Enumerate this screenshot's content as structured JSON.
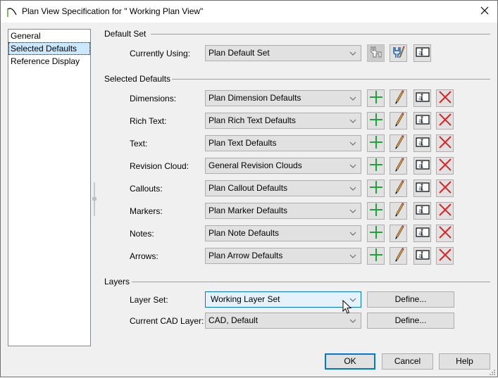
{
  "window": {
    "title": "Plan View Specification for \" Working Plan View\"",
    "app_icon": "arch-icon",
    "close_icon": "close-icon"
  },
  "nav": {
    "items": [
      {
        "label": "General",
        "selected": false
      },
      {
        "label": "Selected Defaults",
        "selected": true
      },
      {
        "label": "Reference Display",
        "selected": false
      }
    ]
  },
  "default_set": {
    "header": "Default Set",
    "label": "Currently Using:",
    "value": "Plan Default Set",
    "buttons": [
      {
        "icon": "save-defaults-icon",
        "enabled": false
      },
      {
        "icon": "edit-defaults-icon",
        "enabled": true
      },
      {
        "icon": "rename-icon",
        "enabled": true
      }
    ]
  },
  "selected_defaults": {
    "header": "Selected Defaults",
    "rows": [
      {
        "label": "Dimensions:",
        "value": "Plan Dimension Defaults"
      },
      {
        "label": "Rich Text:",
        "value": "Plan Rich Text Defaults"
      },
      {
        "label": "Text:",
        "value": "Plan Text Defaults"
      },
      {
        "label": "Revision Cloud:",
        "value": "General Revision Clouds"
      },
      {
        "label": "Callouts:",
        "value": "Plan Callout Defaults"
      },
      {
        "label": "Markers:",
        "value": "Plan Marker Defaults"
      },
      {
        "label": "Notes:",
        "value": "Plan Note Defaults"
      },
      {
        "label": "Arrows:",
        "value": "Plan Arrow Defaults"
      }
    ],
    "row_buttons": [
      {
        "icon": "add-icon"
      },
      {
        "icon": "edit-pencil-icon"
      },
      {
        "icon": "rename-icon"
      },
      {
        "icon": "delete-icon"
      }
    ]
  },
  "layers": {
    "header": "Layers",
    "layer_set_label": "Layer Set:",
    "layer_set_value": "Working Layer Set",
    "cad_layer_label": "Current CAD Layer:",
    "cad_layer_value": "CAD,  Default",
    "define_label": "Define..."
  },
  "footer": {
    "ok": "OK",
    "cancel": "Cancel",
    "help": "Help"
  },
  "colors": {
    "accent": "#0078d7",
    "selection": "#cce8ff",
    "add_green": "#22a33a",
    "delete_red": "#e02020",
    "pencil_yellow": "#f5a623"
  }
}
